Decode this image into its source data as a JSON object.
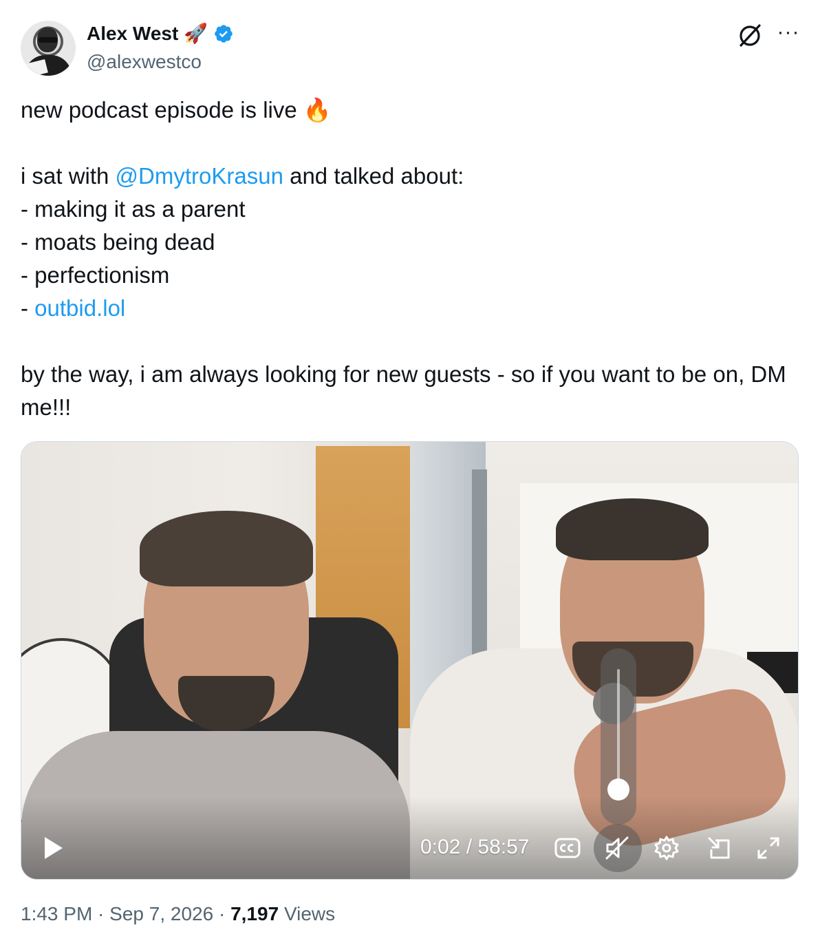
{
  "author": {
    "name": "Alex West",
    "emoji": "🚀",
    "handle": "@alexwestco",
    "verified_color": "#1d9bf0"
  },
  "icons": {
    "grok": "grok-icon",
    "more": "more-icon",
    "more_glyph": "···"
  },
  "tweet": {
    "line1_text": "new podcast episode is live ",
    "line1_emoji": "🔥",
    "line2_before": "i sat with ",
    "mention": "@DmytroKrasun",
    "line2_after": " and talked about:",
    "bullet1": "- making it as a parent",
    "bullet2": "- moats being dead",
    "bullet3": "- perfectionism",
    "bullet4_prefix": "- ",
    "bullet4_link": "outbid.lol",
    "closing": "by the way, i am always looking for new guests - so if you want to be on, DM me!!!"
  },
  "video": {
    "current_time": "0:02",
    "separator": " / ",
    "duration": "58:57",
    "volume_level": 0.08,
    "controls": [
      "play-icon",
      "cc-icon",
      "mute-icon",
      "gear-icon",
      "pip-icon",
      "fullscreen-icon"
    ]
  },
  "meta": {
    "time": "1:43 PM",
    "dot1": " · ",
    "date": "Sep 7, 2026",
    "dot2": " · ",
    "views_count": "7,197",
    "views_label": " Views"
  },
  "colors": {
    "link": "#1d9bf0",
    "text": "#0f1419",
    "muted": "#536471"
  }
}
